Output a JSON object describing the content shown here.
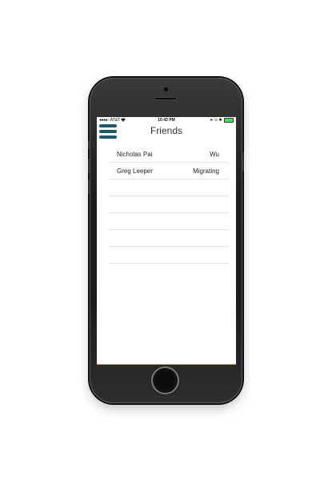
{
  "status_bar": {
    "signal_dots": "●●●●○",
    "carrier": "AT&T",
    "wifi_icon": "wifi-icon",
    "time": "10:43 PM",
    "right_icons": "➤ ⊙ ✱",
    "battery_level": 1.0,
    "battery_color": "#4cd964"
  },
  "header": {
    "title": "Friends",
    "menu_icon": "hamburger-menu-icon",
    "menu_color": "#1c5a66"
  },
  "friends": [
    {
      "name": "Nicholas Pai",
      "status": "Wu"
    },
    {
      "name": "Greg Leeper",
      "status": "Migrating"
    },
    {
      "name": "",
      "status": ""
    },
    {
      "name": "",
      "status": ""
    },
    {
      "name": "",
      "status": ""
    },
    {
      "name": "",
      "status": ""
    },
    {
      "name": "",
      "status": ""
    }
  ]
}
